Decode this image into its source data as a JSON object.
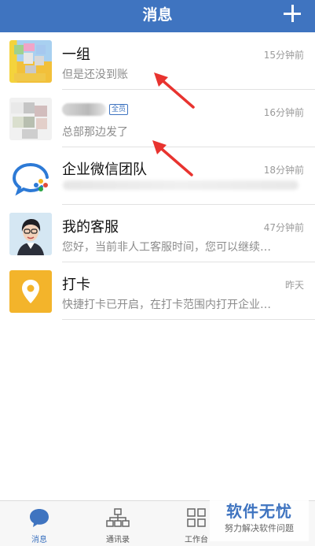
{
  "header": {
    "title": "消息",
    "add_icon": "plus-icon"
  },
  "conversations": [
    {
      "name": "一组",
      "preview": "但是还没到账",
      "time": "15分钟前",
      "avatar": "group-avatar"
    },
    {
      "name": "",
      "badge": "全员",
      "preview": "总部那边发了",
      "time": "16分钟前",
      "avatar": "blurred-avatar"
    },
    {
      "name": "企业微信团队",
      "preview": "",
      "time": "18分钟前",
      "avatar": "wecom-logo-icon"
    },
    {
      "name": "我的客服",
      "preview": "您好，当前非人工客服时间，您可以继续…",
      "time": "47分钟前",
      "avatar": "service-agent-avatar"
    },
    {
      "name": "打卡",
      "preview": "快捷打卡已开启，在打卡范围内打开企业…",
      "time": "昨天",
      "avatar": "location-pin-icon"
    }
  ],
  "tabs": [
    {
      "label": "消息",
      "icon": "chat-bubble-icon",
      "active": true
    },
    {
      "label": "通讯录",
      "icon": "org-chart-icon",
      "active": false
    },
    {
      "label": "工作台",
      "icon": "grid-icon",
      "active": false
    }
  ],
  "watermark": {
    "title": "软件无忧",
    "subtitle": "努力解决软件问题"
  },
  "colors": {
    "accent": "#3f74c0",
    "annotation": "#e8332f"
  }
}
